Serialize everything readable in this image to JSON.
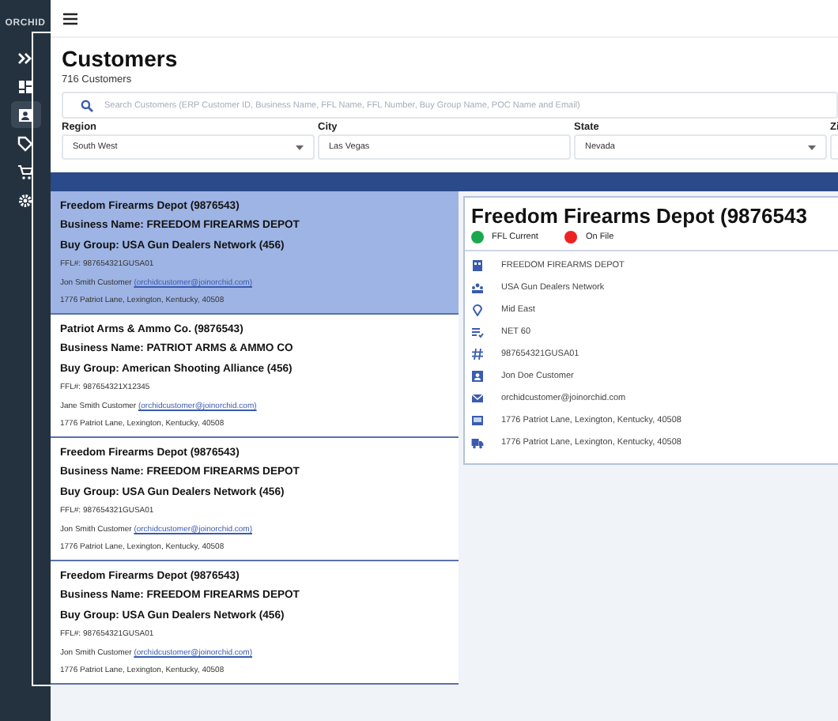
{
  "sidebar": {
    "logo": "ORCHID",
    "items": [
      {
        "kind": "expand",
        "selected": false
      },
      {
        "kind": "dashboard",
        "selected": false
      },
      {
        "kind": "contact",
        "selected": true
      },
      {
        "kind": "tag",
        "selected": false
      },
      {
        "kind": "cart",
        "selected": false
      },
      {
        "kind": "settings",
        "selected": false
      }
    ]
  },
  "page": {
    "title": "Customers",
    "count": "716 Customers"
  },
  "search": {
    "placeholder": "Search Customers (ERP Customer ID, Business Name, FFL Name, FFL Number, Buy Group Name, POC Name and Email)"
  },
  "filters": [
    {
      "label": "Region",
      "value": "South West",
      "kind": "select"
    },
    {
      "label": "City",
      "value": "Las Vegas",
      "kind": "text"
    },
    {
      "label": "State",
      "value": "Nevada",
      "kind": "select"
    },
    {
      "label": "Zi",
      "kind": "text"
    }
  ],
  "customers": [
    {
      "title": "Freedom Firearms Depot (9876543)",
      "business": "Business Name: FREEDOM FIREARMS DEPOT",
      "group": "Buy Group: USA Gun Dealers Network (456)",
      "ffl": "FFL#: 987654321GUSA01",
      "contact": "Jon Smith Customer",
      "email": "(orchidcustomer@joinorchid.com)",
      "address": "1776 Patriot Lane, Lexington, Kentucky, 40508",
      "selected": true
    },
    {
      "title": "Patriot Arms & Ammo Co. (9876543)",
      "business": "Business Name: PATRIOT ARMS & AMMO CO",
      "group": "Buy Group: American Shooting Alliance (456)",
      "ffl": "FFL#: 987654321X12345",
      "contact": "Jane Smith Customer",
      "email": "(orchidcustomer@joinorchid.com)",
      "address": "1776 Patriot Lane, Lexington, Kentucky, 40508",
      "selected": false
    },
    {
      "title": "Freedom Firearms Depot (9876543)",
      "business": "Business Name: FREEDOM FIREARMS DEPOT",
      "group": "Buy Group: USA Gun Dealers Network (456)",
      "ffl": "FFL#: 987654321GUSA01",
      "contact": "Jon Smith Customer",
      "email": "(orchidcustomer@joinorchid.com)",
      "address": "1776 Patriot Lane, Lexington, Kentucky, 40508",
      "selected": false
    },
    {
      "title": "Freedom Firearms Depot (9876543)",
      "business": "Business Name: FREEDOM FIREARMS DEPOT",
      "group": "Buy Group: USA Gun Dealers Network (456)",
      "ffl": "FFL#: 987654321GUSA01",
      "contact": "Jon Smith Customer",
      "email": "(orchidcustomer@joinorchid.com)",
      "address": "1776 Patriot Lane, Lexington, Kentucky, 40508",
      "selected": false
    }
  ],
  "detail": {
    "title": "Freedom Firearms Depot (9876543",
    "statuses": [
      {
        "label": "FFL Current",
        "color": "#1aa84f"
      },
      {
        "label": "On File",
        "color": "#ee2222"
      }
    ],
    "fields": [
      {
        "kind": "building",
        "value": "FREEDOM FIREARMS DEPOT"
      },
      {
        "kind": "group",
        "value": "USA Gun Dealers Network"
      },
      {
        "kind": "location",
        "value": "Mid East"
      },
      {
        "kind": "terms",
        "value": "NET 60"
      },
      {
        "kind": "number",
        "value": "987654321GUSA01"
      },
      {
        "kind": "contact",
        "value": "Jon Doe Customer"
      },
      {
        "kind": "email",
        "value": "orchidcustomer@joinorchid.com"
      },
      {
        "kind": "billing",
        "value": "1776 Patriot Lane, Lexington, Kentucky, 40508"
      },
      {
        "kind": "shipping",
        "value": "1776 Patriot Lane, Lexington, Kentucky, 40508"
      }
    ]
  }
}
